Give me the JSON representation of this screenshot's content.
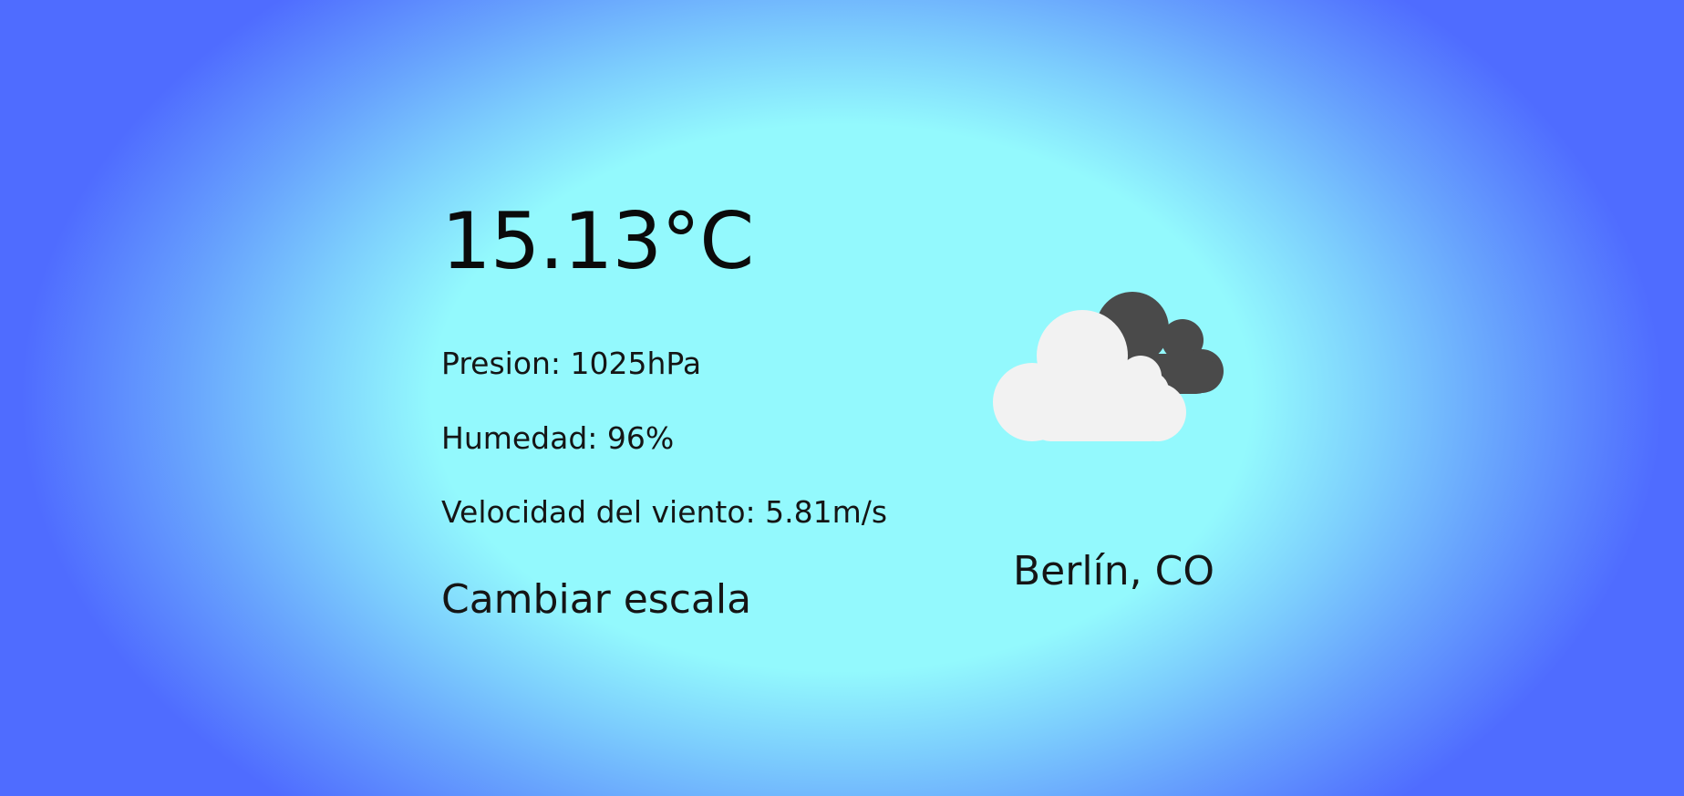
{
  "weather": {
    "temperature": "15.13°C",
    "pressure": "Presion: 1025hPa",
    "humidity": "Humedad: 96%",
    "wind_speed": "Velocidad del viento: 5.81m/s",
    "change_scale_label": "Cambiar escala",
    "location": "Berlín, CO",
    "icon": "partly-cloudy-dark-icon"
  },
  "colors": {
    "background_center": "#93f9fd",
    "background_edge": "#4f6cff",
    "cloud_light": "#f2f2f2",
    "cloud_dark": "#4a4a4a",
    "text": "#111111"
  }
}
